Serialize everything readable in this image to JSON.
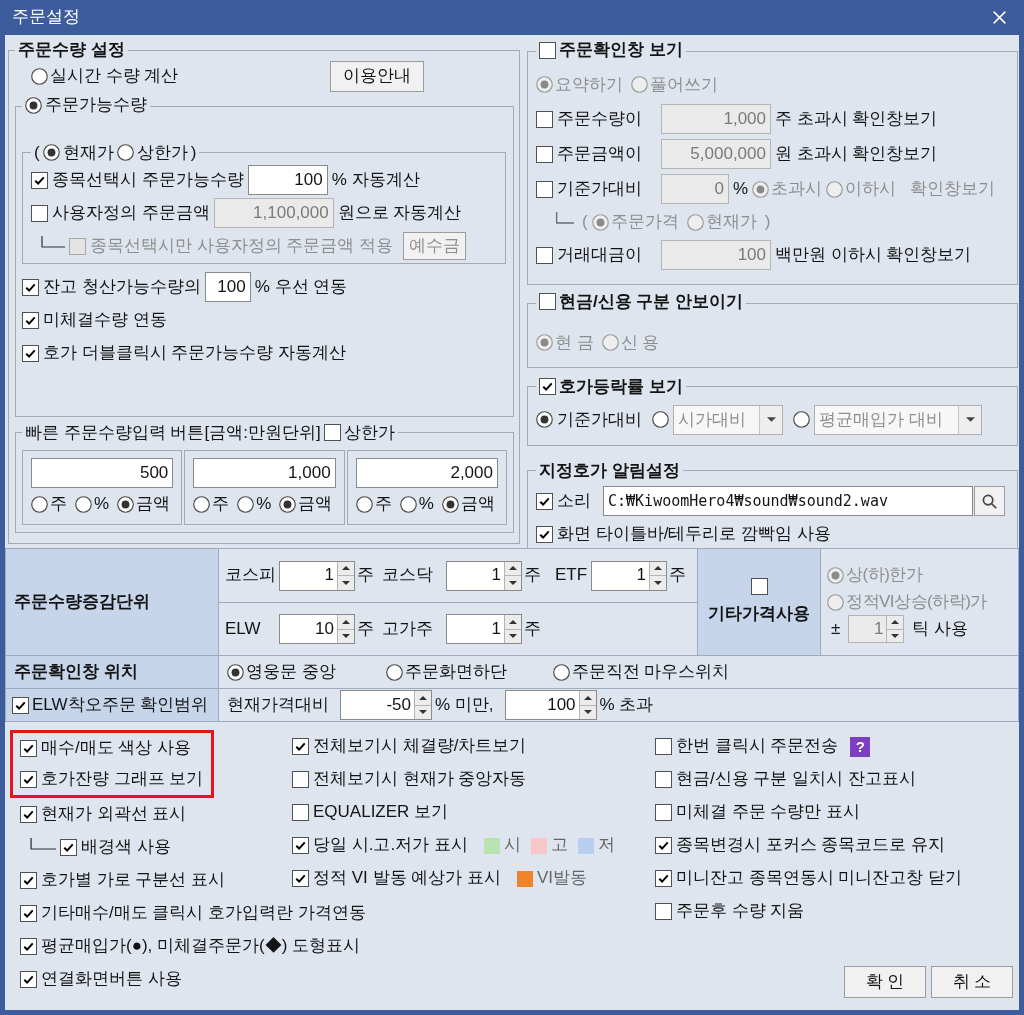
{
  "window": {
    "title": "주문설정"
  },
  "order_quantity": {
    "title": "주문수량 설정",
    "realtime": {
      "label": "실시간 수량 계산",
      "selected": false
    },
    "guide_button": "이용안내",
    "available": {
      "label": "주문가능수량",
      "selected": true,
      "basis": {
        "open": "(",
        "close": ")",
        "options": [
          {
            "label": "현재가",
            "selected": true
          },
          {
            "label": "상한가",
            "selected": false
          }
        ],
        "rows": [
          {
            "label": "종목선택시 주문가능수량",
            "checked": true,
            "disabled": false,
            "branch": false,
            "field": {
              "value": "100",
              "disabled": false
            },
            "suffix": "% 자동계산"
          },
          {
            "label": "사용자정의 주문금액",
            "checked": false,
            "disabled": false,
            "branch": false,
            "field": {
              "value": "1,100,000",
              "disabled": true
            },
            "suffix": "원으로 자동계산"
          },
          {
            "label": "종목선택시만 사용자정의 주문금액 적용",
            "checked": false,
            "disabled": true,
            "branch": true,
            "button": "예수금"
          }
        ]
      },
      "options": [
        {
          "label": "잔고 청산가능수량의",
          "checked": true,
          "field": {
            "value": "100",
            "disabled": false
          },
          "suffix": "% 우선 연동"
        },
        {
          "label": "미체결수량 연동",
          "checked": true
        },
        {
          "label": "호가 더블클릭시 주문가능수량 자동계산",
          "checked": true
        }
      ]
    },
    "quick_input": {
      "title": "빠른 주문수량입력 버튼[금액:만원단위]",
      "upper_limit": {
        "label": "상한가",
        "checked": false
      },
      "slots": [
        {
          "value": "500",
          "units": [
            {
              "label": "주",
              "selected": false
            },
            {
              "label": "%",
              "selected": false
            },
            {
              "label": "금액",
              "selected": true
            }
          ]
        },
        {
          "value": "1,000",
          "units": [
            {
              "label": "주",
              "selected": false
            },
            {
              "label": "%",
              "selected": false
            },
            {
              "label": "금액",
              "selected": true
            }
          ]
        },
        {
          "value": "2,000",
          "units": [
            {
              "label": "주",
              "selected": false
            },
            {
              "label": "%",
              "selected": false
            },
            {
              "label": "금액",
              "selected": true
            }
          ]
        }
      ]
    }
  },
  "confirm_window": {
    "title": "주문확인창 보기",
    "checked": false,
    "modes": [
      {
        "label": "요약하기",
        "selected": true,
        "disabled": true
      },
      {
        "label": "풀어쓰기",
        "selected": false,
        "disabled": true
      }
    ],
    "conditions": [
      {
        "label": "주문수량이",
        "checked": false,
        "field": {
          "value": "1,000",
          "disabled": true
        },
        "suffix": "주 초과시 확인창보기"
      },
      {
        "label": "주문금액이",
        "checked": false,
        "field": {
          "value": "5,000,000",
          "disabled": true
        },
        "suffix": "원 초과시 확인창보기"
      },
      {
        "label": "기준가대비",
        "checked": false,
        "field": {
          "value": "0",
          "disabled": true
        },
        "suffix": "%",
        "choices": [
          {
            "label": "초과시",
            "selected": true,
            "disabled": true
          },
          {
            "label": "이하시",
            "selected": false,
            "disabled": true
          }
        ],
        "tail": {
          "text": "확인창보기",
          "disabled": true
        },
        "sub": {
          "open": "(",
          "close": ")",
          "disabled": true,
          "choices": [
            {
              "label": "주문가격",
              "selected": true
            },
            {
              "label": "현재가",
              "selected": false
            }
          ]
        }
      },
      {
        "label": "거래대금이",
        "checked": false,
        "field": {
          "value": "100",
          "disabled": true
        },
        "suffix": "백만원 이하시 확인창보기"
      }
    ]
  },
  "cash_credit": {
    "title": "현금/신용 구분 안보이기",
    "checked": false,
    "options": [
      {
        "label": "현 금",
        "selected": true,
        "disabled": true
      },
      {
        "label": "신 용",
        "selected": false,
        "disabled": true
      }
    ]
  },
  "price_change": {
    "title": "호가등락률 보기",
    "checked": true,
    "options": [
      {
        "kind": "label",
        "label": "기준가대비",
        "selected": true,
        "disabled": false
      },
      {
        "kind": "dropdown",
        "label": "시가대비",
        "selected": false,
        "disabled": true
      },
      {
        "kind": "dropdown",
        "label": "평균매입가 대비",
        "selected": false,
        "disabled": true
      }
    ]
  },
  "price_alert": {
    "title": "지정호가 알림설정",
    "sound": {
      "label": "소리",
      "checked": true,
      "path": "C:₩KiwoomHero4₩sound₩sound2.wav"
    },
    "flash": {
      "label": "화면 타이틀바/테두리로 깜빡임 사용",
      "checked": true
    }
  },
  "settings_grid": {
    "step": {
      "header": "주문수량증감단위",
      "lines": [
        [
          {
            "label": "코스피",
            "value": "1",
            "unit": "주"
          },
          {
            "label": "코스닥",
            "value": "1",
            "unit": "주"
          },
          {
            "label": "ETF",
            "value": "1",
            "unit": "주"
          }
        ],
        [
          {
            "label": "ELW",
            "value": "10",
            "unit": "주"
          },
          {
            "label": "고가주",
            "value": "1",
            "unit": "주"
          }
        ]
      ]
    },
    "other_price": {
      "label": "기타가격사용",
      "checked": false,
      "options": [
        {
          "label": "상(하)한가",
          "selected": true,
          "disabled": true
        },
        {
          "label": "정적VI상승(하락)가",
          "selected": false,
          "disabled": true
        }
      ],
      "tick": {
        "sign": "±",
        "value": "1",
        "disabled": true,
        "unit": "틱 사용"
      }
    },
    "position": {
      "header": "주문확인창 위치",
      "options": [
        {
          "label": "영웅문 중앙",
          "selected": true
        },
        {
          "label": "주문화면하단",
          "selected": false
        },
        {
          "label": "주문직전 마우스위치",
          "selected": false
        }
      ]
    },
    "elw_range": {
      "label": "ELW착오주문 확인범위",
      "checked": true,
      "prefix": "현재가격대비",
      "low": {
        "value": "-50",
        "unit": "% 미만,"
      },
      "high": {
        "value": "100",
        "unit": "% 초과"
      }
    }
  },
  "display_options": {
    "columns": [
      [
        {
          "label": "매수/매도 색상 사용",
          "checked": true,
          "highlighted": true,
          "branch": false
        },
        {
          "label": "호가잔량 그래프 보기",
          "checked": true,
          "highlighted": true,
          "branch": false
        },
        {
          "label": "현재가 외곽선 표시",
          "checked": true,
          "highlighted": false,
          "branch": false
        },
        {
          "label": "배경색 사용",
          "checked": true,
          "highlighted": false,
          "branch": true
        },
        {
          "label": "호가별 가로 구분선 표시",
          "checked": true,
          "highlighted": false,
          "branch": false
        },
        {
          "label": "기타매수/매도 클릭시 호가입력란 가격연동",
          "checked": true,
          "highlighted": false,
          "branch": false
        },
        {
          "label": "평균매입가(●), 미체결주문가(◆) 도형표시",
          "checked": true,
          "highlighted": false,
          "branch": false
        },
        {
          "label": "연결화면버튼 사용",
          "checked": true,
          "highlighted": false,
          "branch": false
        }
      ],
      [
        {
          "label": "전체보기시 체결량/차트보기",
          "checked": true,
          "highlighted": false,
          "branch": false
        },
        {
          "label": "전체보기시 현재가 중앙자동",
          "checked": false,
          "highlighted": false,
          "branch": false
        },
        {
          "label": "EQUALIZER 보기",
          "checked": false,
          "highlighted": false,
          "branch": false
        },
        {
          "label": "당일 시.고.저가 표시",
          "checked": true,
          "highlighted": false,
          "branch": false,
          "swatches": [
            {
              "label": "시",
              "color": "#b8e2b1"
            },
            {
              "label": "고",
              "color": "#f6c8c8"
            },
            {
              "label": "저",
              "color": "#b9cff1"
            }
          ]
        },
        {
          "label": "정적 VI 발동 예상가 표시",
          "checked": true,
          "highlighted": false,
          "branch": false,
          "swatches": [
            {
              "label": "VI발동",
              "color": "#f0832c"
            }
          ]
        }
      ],
      [
        {
          "label": "한번 클릭시 주문전송",
          "checked": false,
          "highlighted": false,
          "branch": false,
          "help": "?"
        },
        {
          "label": "현금/신용 구분 일치시 잔고표시",
          "checked": false,
          "highlighted": false,
          "branch": false
        },
        {
          "label": "미체결 주문 수량만 표시",
          "checked": false,
          "highlighted": false,
          "branch": false
        },
        {
          "label": "종목변경시 포커스 종목코드로 유지",
          "checked": true,
          "highlighted": false,
          "branch": false
        },
        {
          "label": "미니잔고 종목연동시 미니잔고창 닫기",
          "checked": true,
          "highlighted": false,
          "branch": false
        },
        {
          "label": "주문후 수량 지움",
          "checked": false,
          "highlighted": false,
          "branch": false
        }
      ]
    ]
  },
  "buttons": [
    "확 인",
    "취 소"
  ]
}
